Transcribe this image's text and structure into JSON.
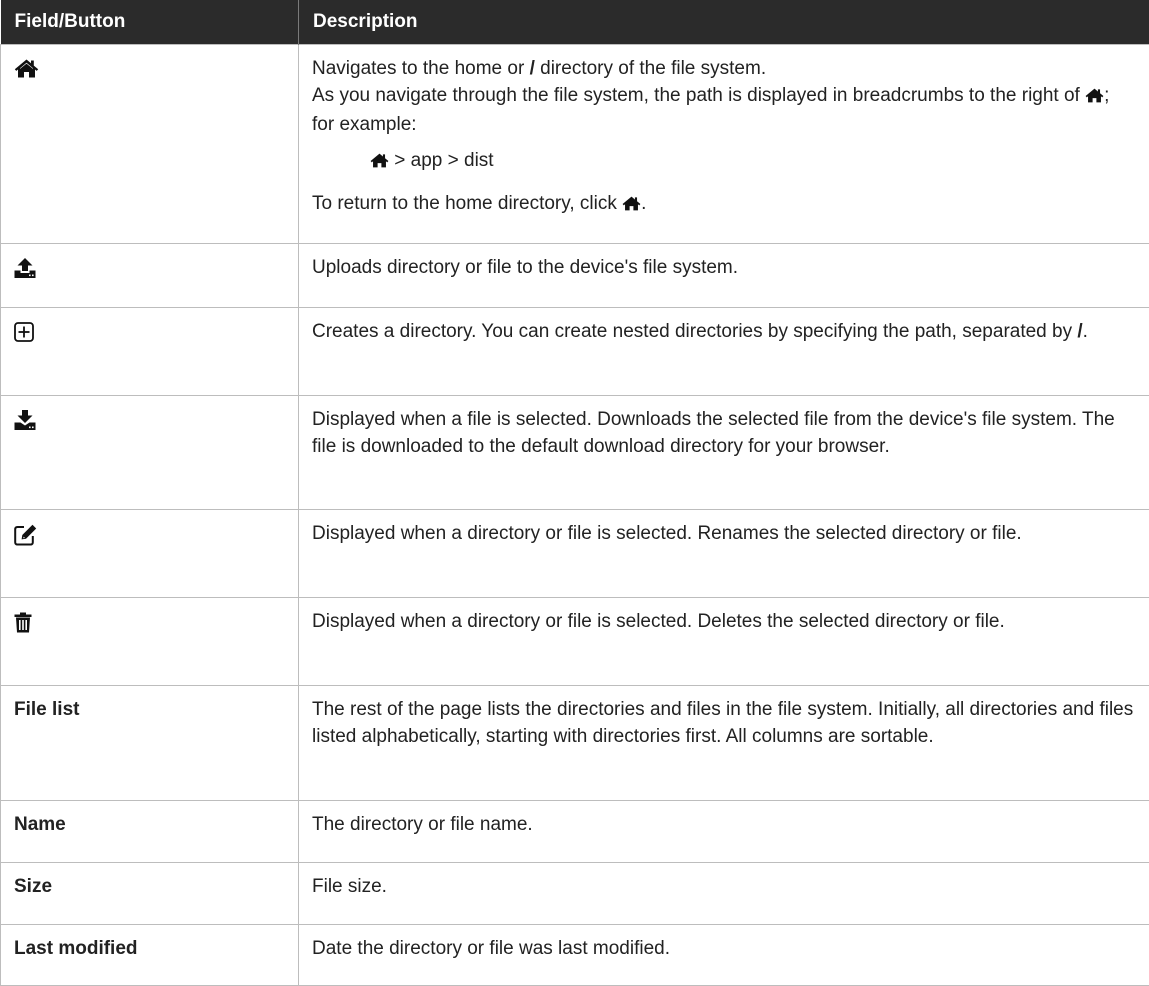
{
  "table": {
    "headers": [
      "Field/Button",
      "Description"
    ],
    "rows": [
      {
        "icon": "home-icon",
        "lines": [
          "Navigates to the home or",
          "/",
          "directory of the file system.",
          "As you navigate through the file system, the path is displayed in breadcrumbs to the right of",
          "; for example:"
        ],
        "example": "> app > dist",
        "return_text": "To return to the home directory, click",
        "return_end": "."
      },
      {
        "icon": "upload-icon",
        "description": "Uploads directory or file to the device's file system."
      },
      {
        "icon": "plus-square-icon",
        "description": "Creates a directory. You can create nested directories by specifying the path, separated by",
        "slash": "/",
        "end": "."
      },
      {
        "icon": "download-icon",
        "description": "Displayed when a file is selected. Downloads the selected file from the device's file system. The file is downloaded to the default download directory for your browser."
      },
      {
        "icon": "edit-icon",
        "description": "Displayed when a directory or file is selected. Renames the selected directory or file."
      },
      {
        "icon": "trash-icon",
        "description": "Displayed when a directory or file is selected. Deletes the selected directory or file."
      },
      {
        "field": "File list",
        "description": "The rest of the page lists the directories and files in the file system. Initially, all directories and files listed alphabetically, starting with directories first. All columns are sortable."
      },
      {
        "field": "Name",
        "description": "The directory or file name."
      },
      {
        "field": "Size",
        "description": "File size."
      },
      {
        "field": "Last modified",
        "description": "Date the directory or file was last modified."
      }
    ]
  }
}
